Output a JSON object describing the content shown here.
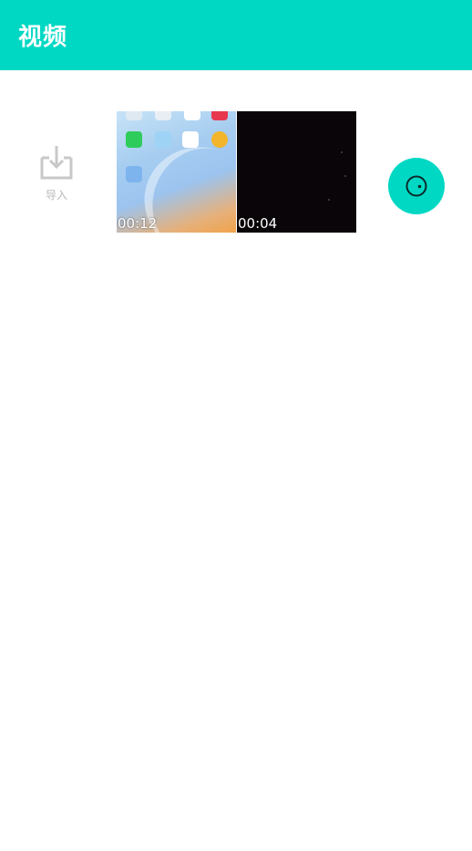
{
  "header": {
    "title": "视频"
  },
  "import": {
    "label": "导入",
    "icon": "import-icon"
  },
  "videos": [
    {
      "duration": "00:12"
    },
    {
      "duration": "00:04"
    }
  ],
  "record_button": {
    "icon": "camera-record-icon"
  },
  "colors": {
    "accent": "#00d8c4",
    "background": "#ffffff",
    "muted_text": "#b8b8b8"
  }
}
